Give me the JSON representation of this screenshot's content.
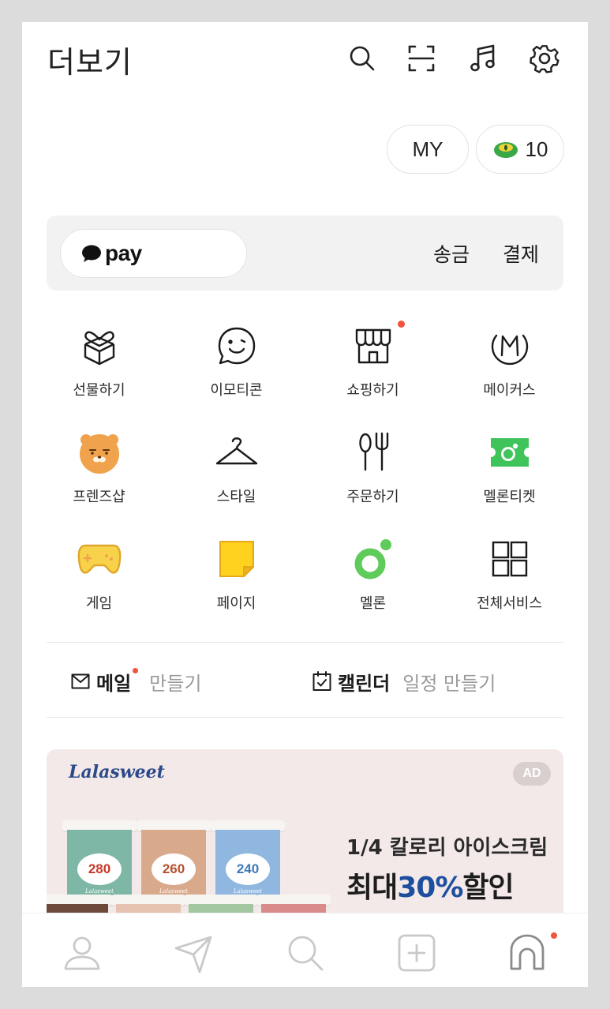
{
  "header": {
    "title": "더보기",
    "icons": [
      "search-icon",
      "scan-icon",
      "music-icon",
      "settings-icon"
    ]
  },
  "pills": {
    "my_label": "MY",
    "coin_count": "10"
  },
  "pay": {
    "brand": "pay",
    "send_label": "송금",
    "pay_label": "결제"
  },
  "grid": [
    {
      "label": "선물하기",
      "icon": "gift-icon"
    },
    {
      "label": "이모티콘",
      "icon": "emoticon-icon"
    },
    {
      "label": "쇼핑하기",
      "icon": "shopping-icon"
    },
    {
      "label": "메이커스",
      "icon": "makers-icon"
    },
    {
      "label": "프렌즈샵",
      "icon": "friends-shop-icon"
    },
    {
      "label": "스타일",
      "icon": "hanger-icon"
    },
    {
      "label": "주문하기",
      "icon": "order-icon"
    },
    {
      "label": "멜론티켓",
      "icon": "melon-ticket-icon"
    },
    {
      "label": "게임",
      "icon": "game-icon"
    },
    {
      "label": "페이지",
      "icon": "page-icon"
    },
    {
      "label": "멜론",
      "icon": "melon-icon"
    },
    {
      "label": "전체서비스",
      "icon": "all-services-icon"
    }
  ],
  "shortcuts": {
    "mail_title": "메일",
    "mail_sub": "만들기",
    "calendar_title": "캘린더",
    "calendar_sub": "일정 만들기"
  },
  "ad": {
    "brand": "Lalasweet",
    "badge": "AD",
    "line1": "1/4 칼로리 아이스크림",
    "line2_prefix": "최대",
    "line2_highlight": "30%",
    "line2_suffix": "할인",
    "cups": [
      "280",
      "260",
      "240"
    ]
  },
  "colors": {
    "accent_dot": "#f2533e",
    "melon_green": "#5ecb5a",
    "ryan_orange": "#f0a24c",
    "game_yellow": "#f7d24a",
    "page_yellow": "#ffd21f",
    "ad_highlight": "#1d4f9e"
  },
  "bottom_nav": [
    "friends-icon",
    "send-icon",
    "search-icon",
    "add-icon",
    "home-icon"
  ]
}
